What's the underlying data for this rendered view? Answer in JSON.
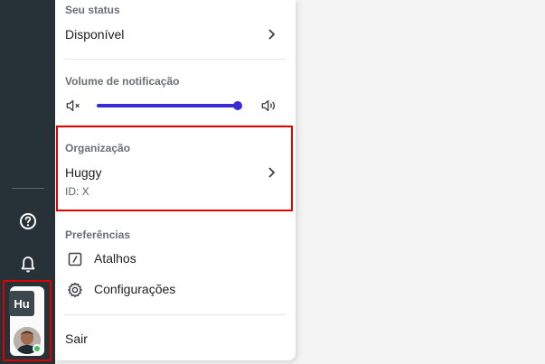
{
  "status": {
    "section_label": "Seu status",
    "value": "Disponível"
  },
  "volume": {
    "section_label": "Volume de notificação",
    "level_percent": 100,
    "color": "#3b2bd6"
  },
  "organization": {
    "section_label": "Organização",
    "name": "Huggy",
    "id_text": "ID: X"
  },
  "preferences": {
    "section_label": "Preferências",
    "items": [
      {
        "label": "Atalhos",
        "icon": "shortcut-icon"
      },
      {
        "label": "Configurações",
        "icon": "gear-icon"
      }
    ]
  },
  "logout_label": "Sair",
  "sidebar": {
    "org_badge": "Hu",
    "help_icon": "help-icon",
    "bell_icon": "bell-icon",
    "status_color": "#3cc45a"
  }
}
